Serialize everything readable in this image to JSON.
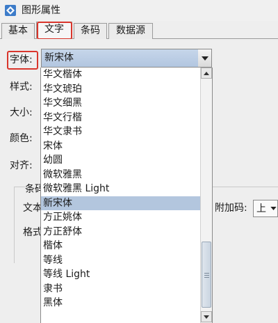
{
  "window": {
    "title": "图形属性",
    "icon": "app-diamond-icon"
  },
  "tabs": [
    {
      "label": "基本"
    },
    {
      "label": "文字",
      "active": true
    },
    {
      "label": "条码"
    },
    {
      "label": "数据源"
    }
  ],
  "form": {
    "font_label": "字体:",
    "style_label": "样式:",
    "size_label": "大小:",
    "color_label": "颜色:",
    "align_label": "对齐:",
    "font_value": "新宋体"
  },
  "barcode_group": {
    "title": "条码文",
    "text_label": "文本",
    "format_label": "格式",
    "attach_label": "附加码:",
    "attach_value": "上"
  },
  "font_list": {
    "selected": "新宋体",
    "items": [
      "华文楷体",
      "华文琥珀",
      "华文细黑",
      "华文行楷",
      "华文隶书",
      "宋体",
      "幼圆",
      "微软雅黑",
      "微软雅黑 Light",
      "新宋体",
      "方正姚体",
      "方正舒体",
      "楷体",
      "等线",
      "等线 Light",
      "隶书",
      "黑体"
    ]
  },
  "colors": {
    "highlight": "#d9352b",
    "selection": "#b3c6de"
  }
}
